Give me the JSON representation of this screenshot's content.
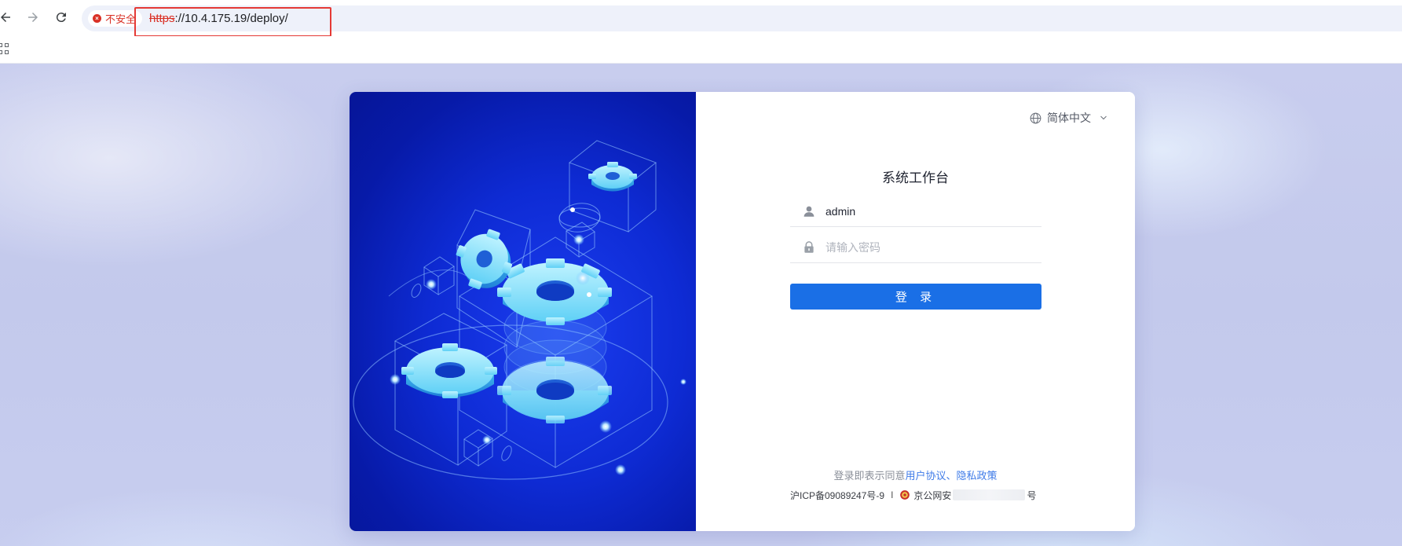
{
  "browser": {
    "security_label": "不安全",
    "url_scheme": "https",
    "url_rest": "://10.4.175.19/deploy/"
  },
  "login": {
    "language": "简体中文",
    "title": "系统工作台",
    "username_value": "admin",
    "password_placeholder": "请输入密码",
    "submit_label": "登 录",
    "agreement_prefix": "登录即表示同意",
    "user_agreement": "用户协议",
    "agreement_sep": "、",
    "privacy_policy": "隐私政策",
    "icp": "沪ICP备09089247号-9",
    "separator": "I",
    "police_prefix": "京公网安",
    "police_suffix": "号"
  },
  "colors": {
    "primary": "#1a6fe6",
    "link": "#3f7be8",
    "warning": "#d93025",
    "highlight_box": "#e53935"
  },
  "icons": {
    "back": "arrow-left-icon",
    "forward": "arrow-right-icon",
    "reload": "reload-icon",
    "security": "warning-circle-icon",
    "apps": "apps-grid-icon",
    "language": "globe-icon",
    "dropdown": "chevron-down-icon",
    "user": "user-icon",
    "password": "lock-icon",
    "police": "police-badge-icon"
  }
}
